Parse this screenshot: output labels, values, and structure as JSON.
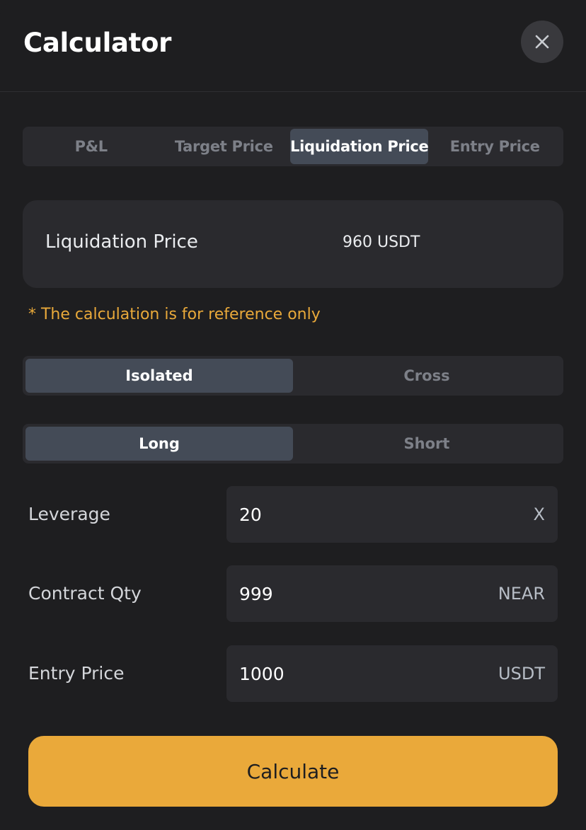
{
  "header": {
    "title": "Calculator",
    "close_icon": "close-icon"
  },
  "tabs": [
    {
      "label": "P&L",
      "active": false
    },
    {
      "label": "Target Price",
      "active": false
    },
    {
      "label": "Liquidation Price",
      "active": true
    },
    {
      "label": "Entry Price",
      "active": false
    }
  ],
  "result": {
    "label": "Liquidation Price",
    "value": "960 USDT"
  },
  "note": "* The calculation is for reference only",
  "margin_mode": {
    "options": [
      "Isolated",
      "Cross"
    ],
    "selected": "Isolated"
  },
  "position_side": {
    "options": [
      "Long",
      "Short"
    ],
    "selected": "Long"
  },
  "fields": {
    "leverage": {
      "label": "Leverage",
      "value": "20",
      "unit": "X"
    },
    "contract_qty": {
      "label": "Contract Qty",
      "value": "999",
      "unit": "NEAR"
    },
    "entry_price": {
      "label": "Entry Price",
      "value": "1000",
      "unit": "USDT"
    }
  },
  "actions": {
    "calculate_label": "Calculate"
  },
  "colors": {
    "background": "#1e1e20",
    "panel": "#2a2a2e",
    "active_segment": "#444b57",
    "accent": "#eaa93a",
    "note": "#e9a93a"
  }
}
